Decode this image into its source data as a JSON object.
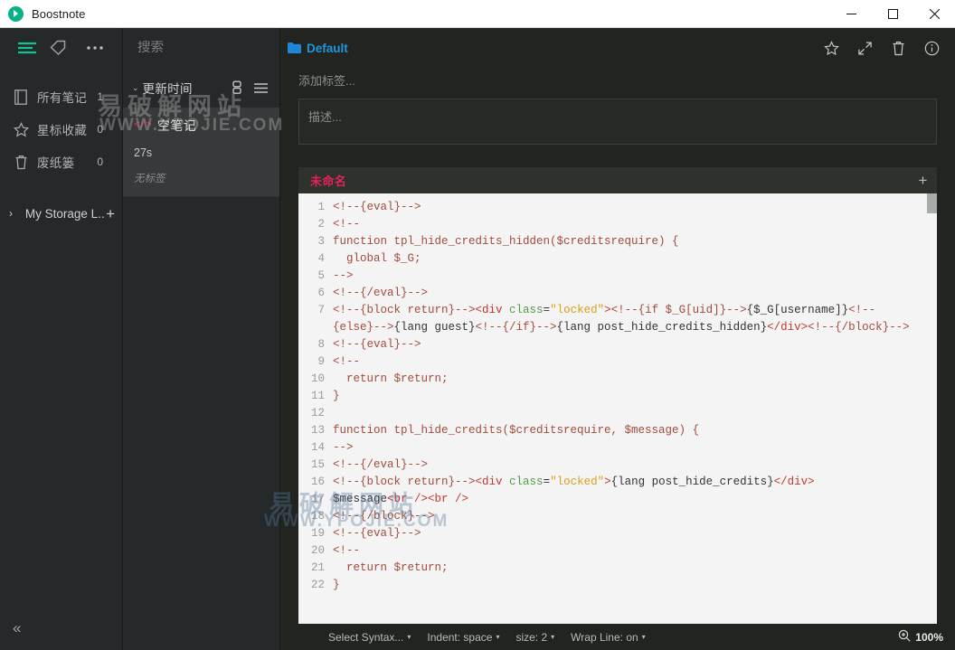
{
  "window": {
    "title": "Boostnote",
    "logo_icon": "boostnote-logo-icon",
    "minimize_icon": "minimize-icon",
    "maximize_icon": "maximize-icon",
    "close_icon": "close-icon"
  },
  "sidebar": {
    "top_icons": [
      {
        "name": "notes-list-icon",
        "glyph": "list"
      },
      {
        "name": "tag-icon",
        "glyph": "tag"
      },
      {
        "name": "more-options-icon",
        "glyph": "dots"
      }
    ],
    "items": [
      {
        "label": "所有笔记",
        "count": "1",
        "icon": "book-icon"
      },
      {
        "label": "星标收藏",
        "count": "0",
        "icon": "star-icon"
      },
      {
        "label": "废纸篓",
        "count": "0",
        "icon": "trash-icon"
      }
    ],
    "storage": {
      "chevron": "›",
      "name": "My Storage L..",
      "add_icon": "plus-icon"
    },
    "collapse_icon": "chevron-double-left-icon",
    "collapse_glyph": "«"
  },
  "notelist": {
    "search_placeholder": "搜索",
    "search_value": "",
    "new_note_icon": "compose-icon",
    "sort": {
      "caret": "⌄",
      "label": "更新时间"
    },
    "view_icons": [
      {
        "name": "compact-view-icon"
      },
      {
        "name": "list-view-icon"
      }
    ],
    "notes": [
      {
        "type_icon": "code-snippet-icon",
        "type_glyph": "</>",
        "title": "空笔记",
        "time": "27s",
        "tags": "无标签"
      }
    ]
  },
  "detail": {
    "folder": {
      "icon": "folder-icon",
      "name": "Default"
    },
    "actions": [
      {
        "name": "star-button",
        "icon": "star-icon"
      },
      {
        "name": "fullscreen-button",
        "icon": "expand-icon"
      },
      {
        "name": "delete-button",
        "icon": "trash-icon"
      },
      {
        "name": "info-button",
        "icon": "info-icon"
      }
    ],
    "tags_placeholder": "添加标签...",
    "description_placeholder": "描述...",
    "description_value": "",
    "editor": {
      "snippet_title": "未命名",
      "add_snippet_icon": "plus-icon",
      "lines": [
        {
          "n": "1",
          "tokens": [
            {
              "c": "cmt",
              "t": "<!--{eval}-->"
            }
          ]
        },
        {
          "n": "2",
          "tokens": [
            {
              "c": "cmt",
              "t": "<!--"
            }
          ]
        },
        {
          "n": "3",
          "tokens": [
            {
              "c": "kw",
              "t": "function tpl_hide_credits_hidden($creditsrequire) {"
            }
          ]
        },
        {
          "n": "4",
          "tokens": [
            {
              "c": "kw",
              "t": "  global $_G;"
            }
          ]
        },
        {
          "n": "5",
          "tokens": [
            {
              "c": "cmt",
              "t": "-->"
            }
          ]
        },
        {
          "n": "6",
          "tokens": [
            {
              "c": "cmt",
              "t": "<!--{/eval}-->"
            }
          ]
        },
        {
          "n": "7",
          "tokens": [
            {
              "c": "cmt",
              "t": "<!--{block return}-->"
            },
            {
              "c": "tag",
              "t": "<div "
            },
            {
              "c": "attr",
              "t": "class"
            },
            {
              "c": "txt",
              "t": "="
            },
            {
              "c": "str",
              "t": "\"locked\""
            },
            {
              "c": "tag",
              "t": ">"
            },
            {
              "c": "cmt",
              "t": "<!--{if $_G[uid]}-->"
            },
            {
              "c": "txt",
              "t": "{$_G[username]}"
            },
            {
              "c": "cmt",
              "t": "<!--{else}-->"
            },
            {
              "c": "txt",
              "t": "{lang guest}"
            },
            {
              "c": "cmt",
              "t": "<!--{/if}-->"
            },
            {
              "c": "txt",
              "t": "{lang post_hide_credits_hidden}"
            },
            {
              "c": "tag",
              "t": "</div>"
            },
            {
              "c": "cmt",
              "t": "<!--{/block}-->"
            }
          ]
        },
        {
          "n": "8",
          "tokens": [
            {
              "c": "cmt",
              "t": "<!--{eval}-->"
            }
          ]
        },
        {
          "n": "9",
          "tokens": [
            {
              "c": "cmt",
              "t": "<!--"
            }
          ]
        },
        {
          "n": "10",
          "tokens": [
            {
              "c": "kw",
              "t": "  return $return;"
            }
          ]
        },
        {
          "n": "11",
          "tokens": [
            {
              "c": "kw",
              "t": "}"
            }
          ]
        },
        {
          "n": "12",
          "tokens": [
            {
              "c": "txt",
              "t": ""
            }
          ]
        },
        {
          "n": "13",
          "tokens": [
            {
              "c": "kw",
              "t": "function tpl_hide_credits($creditsrequire, $message) {"
            }
          ]
        },
        {
          "n": "14",
          "tokens": [
            {
              "c": "cmt",
              "t": "-->"
            }
          ]
        },
        {
          "n": "15",
          "tokens": [
            {
              "c": "cmt",
              "t": "<!--{/eval}-->"
            }
          ]
        },
        {
          "n": "16",
          "tokens": [
            {
              "c": "cmt",
              "t": "<!--{block return}-->"
            },
            {
              "c": "tag",
              "t": "<div "
            },
            {
              "c": "attr",
              "t": "class"
            },
            {
              "c": "txt",
              "t": "="
            },
            {
              "c": "str",
              "t": "\"locked\""
            },
            {
              "c": "tag",
              "t": ">"
            },
            {
              "c": "txt",
              "t": "{lang post_hide_credits}"
            },
            {
              "c": "tag",
              "t": "</div>"
            }
          ]
        },
        {
          "n": "17",
          "tokens": [
            {
              "c": "txt",
              "t": "$message"
            },
            {
              "c": "tag",
              "t": "<br /><br />"
            }
          ]
        },
        {
          "n": "18",
          "tokens": [
            {
              "c": "cmt",
              "t": "<!--{/block}-->"
            }
          ]
        },
        {
          "n": "19",
          "tokens": [
            {
              "c": "cmt",
              "t": "<!--{eval}-->"
            }
          ]
        },
        {
          "n": "20",
          "tokens": [
            {
              "c": "cmt",
              "t": "<!--"
            }
          ]
        },
        {
          "n": "21",
          "tokens": [
            {
              "c": "kw",
              "t": "  return $return;"
            }
          ]
        },
        {
          "n": "22",
          "tokens": [
            {
              "c": "kw",
              "t": "}"
            }
          ]
        }
      ]
    },
    "status": {
      "syntax": {
        "label": "Select Syntax...",
        "caret": "▾"
      },
      "indent": {
        "label": "Indent: space",
        "caret": "▾"
      },
      "size": {
        "label": "size: 2",
        "caret": "▾"
      },
      "wrap": {
        "label": "Wrap Line: on",
        "caret": "▾"
      },
      "zoom": {
        "icon": "zoom-in-icon",
        "value": "100%"
      }
    }
  },
  "watermarks": {
    "cn": "易破解网站",
    "en": "WWW.YPOJIE.COM"
  }
}
